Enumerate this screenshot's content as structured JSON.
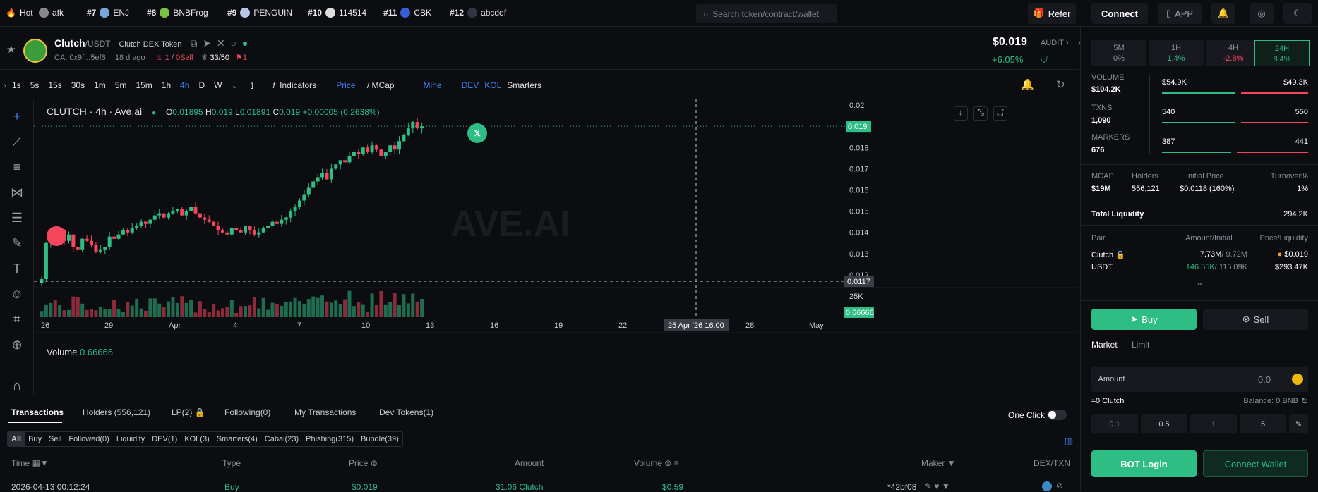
{
  "topbar": {
    "hot_label": "Hot",
    "items": [
      {
        "label": "afk",
        "rank": ""
      },
      {
        "label": "ENJ",
        "rank": "#7"
      },
      {
        "label": "BNBFrog",
        "rank": "#8"
      },
      {
        "label": "PENGUIN",
        "rank": "#9"
      },
      {
        "label": "114514",
        "rank": "#10"
      },
      {
        "label": "CBK",
        "rank": "#11"
      },
      {
        "label": "abcdef",
        "rank": "#12"
      }
    ],
    "search_placeholder": "Search token/contract/wallet",
    "refer": "Refer",
    "connect": "Connect",
    "app": "APP"
  },
  "token": {
    "name": "Clutch",
    "pair": "/USDT",
    "dex": "Clutch DEX Token",
    "ca": "CA: 0x9f...5ef6",
    "age": "18 d ago",
    "tax_buy": "1",
    "tax_sep": "/",
    "tax_sell_val": "0",
    "sell_label": "Sell",
    "holders_frac": "33/50",
    "flag_count": "1",
    "price": "$0.019",
    "change": "+6.05%",
    "audit": "AUDIT"
  },
  "toolbar": {
    "intervals": [
      "1s",
      "5s",
      "15s",
      "30s",
      "1m",
      "5m",
      "15m",
      "1h",
      "4h",
      "D",
      "W"
    ],
    "active_interval": "4h",
    "indicators": "Indicators",
    "price": "Price",
    "mcap": "/ MCap",
    "mine": "Mine",
    "dev": "DEV",
    "kol": "KOL",
    "smarters": "Smarters"
  },
  "chart_data": {
    "type": "candlestick",
    "title": "CLUTCH · 4h · Ave.ai",
    "ohlc_label": {
      "o": "0.01895",
      "h": "0.019",
      "l": "0.01891",
      "c": "0.019",
      "chg": "+0.00005 (0.2638%)"
    },
    "watermark": "AVE.AI",
    "y_ticks": [
      "0.02",
      "0.019",
      "0.018",
      "0.017",
      "0.016",
      "0.015",
      "0.014",
      "0.013",
      "0.012"
    ],
    "ylim": [
      0.0115,
      0.0203
    ],
    "current_price": "0.019",
    "crosshair_price": "0.0117",
    "x_ticks": [
      "26",
      "29",
      "Apr",
      "4",
      "7",
      "10",
      "13",
      "16",
      "19",
      "22",
      "28",
      "May"
    ],
    "crosshair_time": "25 Apr '26   16:00",
    "volume_label": "Volume",
    "volume_value": "0.66666",
    "volume_tick": "25K",
    "volume_badge": "0.66666",
    "close_series": [
      0.0118,
      0.0135,
      0.0139,
      0.0138,
      0.0141,
      0.0136,
      0.0139,
      0.0133,
      0.0132,
      0.0137,
      0.0136,
      0.0134,
      0.0131,
      0.0132,
      0.0133,
      0.0138,
      0.0137,
      0.0139,
      0.0141,
      0.014,
      0.0142,
      0.0143,
      0.0145,
      0.0144,
      0.0146,
      0.0148,
      0.0149,
      0.0147,
      0.0149,
      0.015,
      0.0151,
      0.0148,
      0.015,
      0.0152,
      0.0149,
      0.0147,
      0.0146,
      0.0145,
      0.0143,
      0.0141,
      0.014,
      0.0139,
      0.0142,
      0.0141,
      0.014,
      0.0143,
      0.0141,
      0.0139,
      0.014,
      0.0142,
      0.0143,
      0.0145,
      0.0144,
      0.0146,
      0.0147,
      0.015,
      0.0152,
      0.0155,
      0.0158,
      0.0161,
      0.0164,
      0.0166,
      0.0168,
      0.0165,
      0.017,
      0.0172,
      0.0174,
      0.0173,
      0.0176,
      0.0178,
      0.0177,
      0.018,
      0.0178,
      0.0181,
      0.0179,
      0.0176,
      0.0178,
      0.0181,
      0.0179,
      0.0183,
      0.0186,
      0.0189,
      0.0192,
      0.0189,
      0.019
    ]
  },
  "bottom": {
    "tabs": [
      "Transactions",
      "Holders (556,121)",
      "LP(2)",
      "Following(0)",
      "My Transactions",
      "Dev Tokens(1)"
    ],
    "one_click": "One Click",
    "filters": [
      "All",
      "Buy",
      "Sell",
      "Followed(0)",
      "Liquidity",
      "DEV(1)",
      "KOL(3)",
      "Smarters(4)",
      "Cabal(23)",
      "Phishing(315)",
      "Bundle(39)"
    ],
    "columns": [
      "Time",
      "Type",
      "Price",
      "Amount",
      "Volume",
      "Maker",
      "DEX/TXN"
    ],
    "row": {
      "time": "2026-04-13 00:12:24",
      "type": "Buy",
      "price": "$0.019",
      "amount": "31.06 Clutch",
      "volume": "$0.59",
      "maker": "*42bf08"
    }
  },
  "right": {
    "timeframes": [
      {
        "label": "5M",
        "value": "0%"
      },
      {
        "label": "1H",
        "value": "1.4%"
      },
      {
        "label": "4H",
        "value": "-2.8%"
      },
      {
        "label": "24H",
        "value": "8.4%"
      }
    ],
    "volume_label": "VOLUME",
    "volume": "$104.2K",
    "vol_buy": "$54.9K",
    "vol_sell": "$49.3K",
    "txns_label": "TXNS",
    "txns": "1,090",
    "tx_buy": "540",
    "tx_sell": "550",
    "makers_label": "MARKERS",
    "makers": "676",
    "mk_buy": "387",
    "mk_sell": "441",
    "mcap_label": "MCAP",
    "mcap": "$19M",
    "holders_label": "Holders",
    "holders": "556,121",
    "initial_label": "Initial Price",
    "initial": "$0.0118 (160%)",
    "turnover_label": "Turnover%",
    "turnover": "1%",
    "liquidity_label": "Total Liquidity",
    "liquidity": "294.2K",
    "pair_label": "Pair",
    "amount_initial_label": "Amount/Initial",
    "price_liq_label": "Price/Liquidity",
    "pair_token": "Clutch",
    "pair_base": "USDT",
    "amt_token": "7.73M",
    "amt_token_init": "/ 9.72M",
    "amt_base": "146.55K",
    "amt_base_init": "/ 115.09K",
    "pair_price": "$0.019",
    "pair_liq": "$293.47K",
    "buy": "Buy",
    "sell": "Sell",
    "market": "Market",
    "limit": "Limit",
    "amount_label": "Amount",
    "amount_value": "0.0",
    "approx": "≈0 Clutch",
    "balance": "Balance: 0 BNB",
    "presets": [
      "0.1",
      "0.5",
      "1",
      "5"
    ],
    "bot_login": "BOT Login",
    "connect_wallet": "Connect Wallet"
  },
  "colors": {
    "up": "#2ebd85",
    "down": "#f6465d",
    "accent": "#3c82f6"
  }
}
